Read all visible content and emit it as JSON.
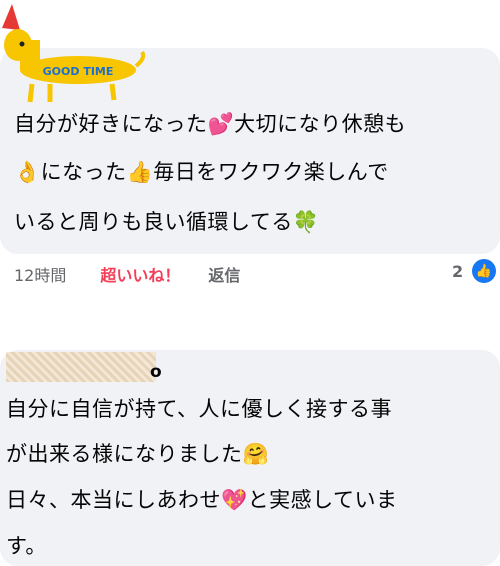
{
  "comment1": {
    "lines": [
      "自分が好きになった💕大切になり休憩も",
      "👌になった👍毎日をワクワク楽しんで",
      "いると周りも良い循環してる🍀"
    ],
    "sticker_text": "GOOD TIME",
    "time": "12時間",
    "reaction_label": "超いいね！",
    "reply_label": "返信",
    "reaction_count": "2"
  },
  "comment2": {
    "author_tail": "o",
    "lines": [
      "自分に自信が持て、人に優しく接する事",
      "が出来る様になりました🤗",
      "日々、本当にしあわせ💖と実感していま",
      "す。"
    ]
  }
}
